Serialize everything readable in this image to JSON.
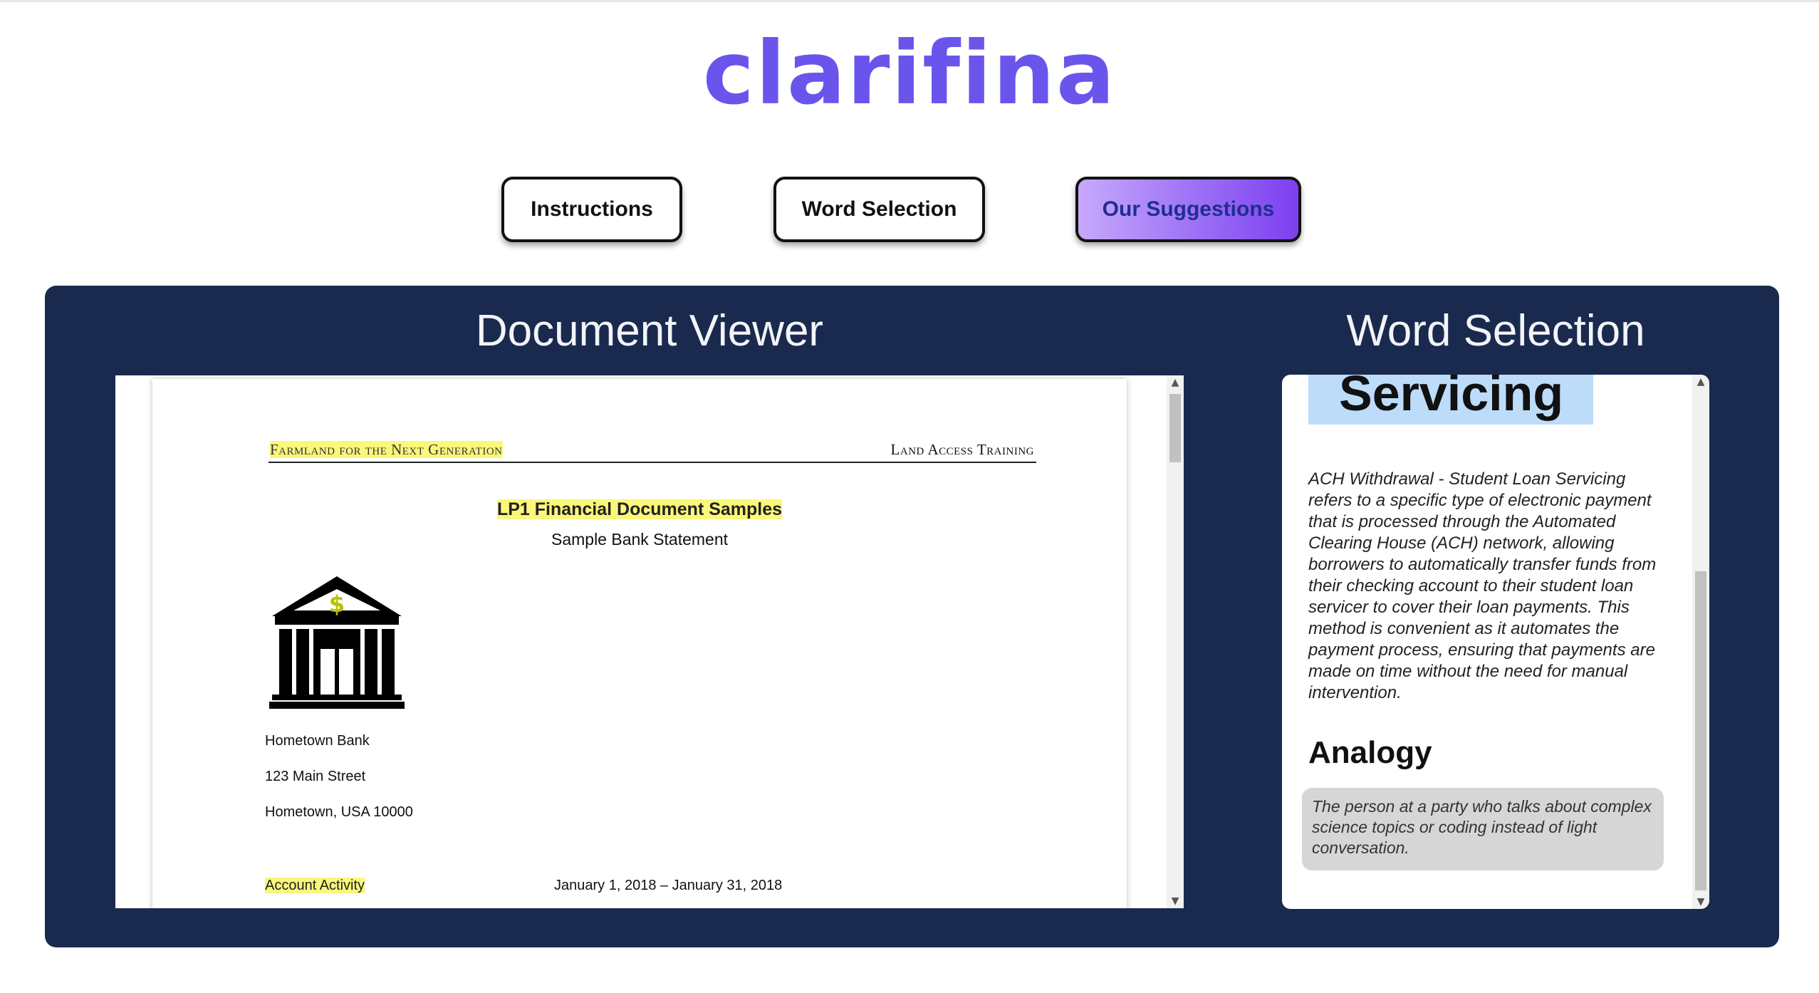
{
  "app": {
    "brand": "clarifina"
  },
  "nav": {
    "instructions": "Instructions",
    "word_selection": "Word Selection",
    "our_suggestions": "Our Suggestions"
  },
  "document_viewer": {
    "title": "Document Viewer",
    "header_left": "Farmland for the Next Generation",
    "header_right": "Land Access Training",
    "doc_title": "LP1 Financial Document Samples",
    "doc_subtitle": "Sample Bank Statement",
    "bank_icon": "bank-building-dollar-icon",
    "bank_name": "Hometown Bank",
    "bank_street": "123 Main Street",
    "bank_city": "Hometown, USA 10000",
    "activity_label": "Account Activity",
    "activity_period": "January 1, 2018 – January 31, 2018"
  },
  "word_selection": {
    "title": "Word Selection",
    "term": "Servicing",
    "definition": "ACH Withdrawal - Student Loan Servicing refers to a specific type of electronic payment that is processed through the Automated Clearing House (ACH) network, allowing borrowers to automatically transfer funds from their checking account to their student loan servicer to cover their loan payments. This method is convenient as it automates the payment process, ensuring that payments are made on time without the need for manual intervention.",
    "analogy_heading": "Analogy",
    "analogy_text": "The person at a party who talks about complex science topics or coding instead of light conversation."
  },
  "colors": {
    "brand": "#6a55ec",
    "panel_bg": "#1a2a4f",
    "highlight": "#fbf77a",
    "term_highlight": "#bcdcfa",
    "active_button": "#9b6ff6"
  }
}
